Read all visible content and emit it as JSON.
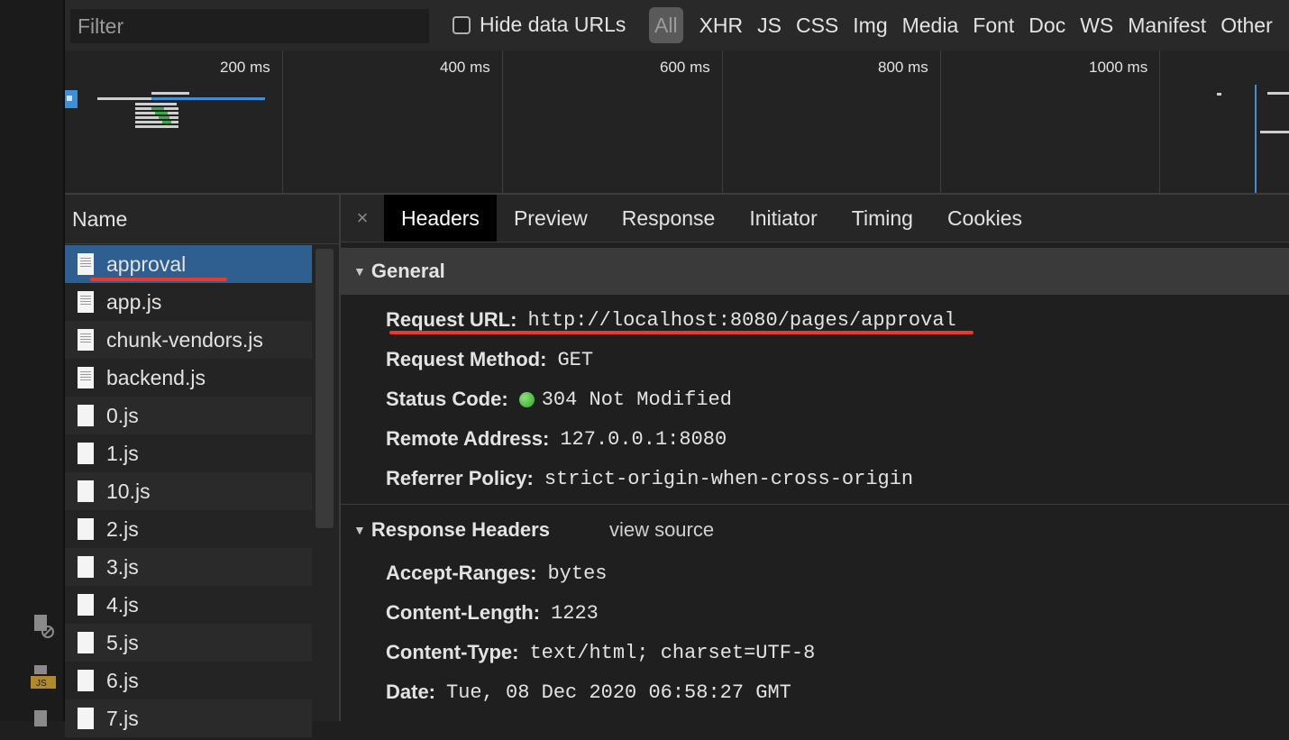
{
  "filter": {
    "placeholder": "Filter"
  },
  "hide_data_urls": {
    "label": "Hide data URLs",
    "checked": false
  },
  "type_filters": [
    "All",
    "XHR",
    "JS",
    "CSS",
    "Img",
    "Media",
    "Font",
    "Doc",
    "WS",
    "Manifest",
    "Other"
  ],
  "timeline": {
    "ticks": [
      "200 ms",
      "400 ms",
      "600 ms",
      "800 ms",
      "1000 ms"
    ]
  },
  "request_list": {
    "header": "Name",
    "rows": [
      {
        "name": "approval",
        "icon": "document-icon"
      },
      {
        "name": "app.js",
        "icon": "document-icon"
      },
      {
        "name": "chunk-vendors.js",
        "icon": "document-icon"
      },
      {
        "name": "backend.js",
        "icon": "document-icon"
      },
      {
        "name": "0.js",
        "icon": "file-icon"
      },
      {
        "name": "1.js",
        "icon": "file-icon"
      },
      {
        "name": "10.js",
        "icon": "file-icon"
      },
      {
        "name": "2.js",
        "icon": "file-icon"
      },
      {
        "name": "3.js",
        "icon": "file-icon"
      },
      {
        "name": "4.js",
        "icon": "file-icon"
      },
      {
        "name": "5.js",
        "icon": "file-icon"
      },
      {
        "name": "6.js",
        "icon": "file-icon"
      },
      {
        "name": "7.js",
        "icon": "file-icon"
      }
    ],
    "selected": "approval"
  },
  "tabs": {
    "close": "×",
    "items": [
      "Headers",
      "Preview",
      "Response",
      "Initiator",
      "Timing",
      "Cookies"
    ],
    "active": "Headers"
  },
  "general": {
    "title": "General",
    "request_url": {
      "key": "Request URL:",
      "value": "http://localhost:8080/pages/approval"
    },
    "request_method": {
      "key": "Request Method:",
      "value": "GET"
    },
    "status_code": {
      "key": "Status Code:",
      "value": "304 Not Modified",
      "status_color": "#3cb534"
    },
    "remote_address": {
      "key": "Remote Address:",
      "value": "127.0.0.1:8080"
    },
    "referrer_policy": {
      "key": "Referrer Policy:",
      "value": "strict-origin-when-cross-origin"
    }
  },
  "response_headers": {
    "title": "Response Headers",
    "view_source": "view source",
    "items": [
      {
        "key": "Accept-Ranges:",
        "value": "bytes"
      },
      {
        "key": "Content-Length:",
        "value": "1223"
      },
      {
        "key": "Content-Type:",
        "value": "text/html; charset=UTF-8"
      },
      {
        "key": "Date:",
        "value": "Tue, 08 Dec 2020 06:58:27 GMT"
      }
    ]
  },
  "colors": {
    "selected_row": "#2f5f90",
    "annotation_red": "#e63b2e",
    "accent_blue": "#3d8fd8"
  }
}
